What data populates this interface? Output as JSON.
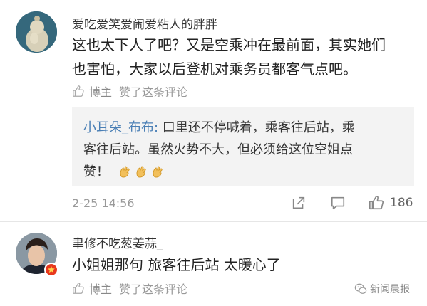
{
  "comments": [
    {
      "username": "爱吃爱笑爱闹爱粘人的胖胖",
      "text_lines": [
        "这也太下人了吧？又是空乘冲在最前面，其实她们",
        "也害怕，大家以后登机对乘务员都客气点吧。"
      ],
      "author_label": "博主",
      "liked_text": "赞了这条评论"
    },
    {
      "username": "聿修不吃葱姜蒜_",
      "text_lines": [
        "小姐姐那句 旅客往后站 太暖心了"
      ],
      "author_label": "博主",
      "liked_text": "赞了这条评论"
    }
  ],
  "reply": {
    "name": "小耳朵_布布:",
    "lines": [
      " 口里还不停喊着，乘客往后站，乘",
      "客往后站。虽然火势不大，但必须给这位空姐点",
      "赞！"
    ],
    "emoji": [
      "clap-emoji",
      "clap-emoji",
      "clap-emoji"
    ]
  },
  "meta": {
    "time": "2-25 14:56",
    "like_count": "186"
  },
  "watermark": "新闻晨报",
  "icons": [
    "thumbs-up-icon",
    "share-icon",
    "comment-icon",
    "like-icon",
    "vip-badge-icon",
    "wechat-icon"
  ],
  "colors": {
    "link": "#4a7fb5",
    "muted": "#999999",
    "badge": "#e8381d",
    "reply_bg": "#f3f3f3"
  }
}
